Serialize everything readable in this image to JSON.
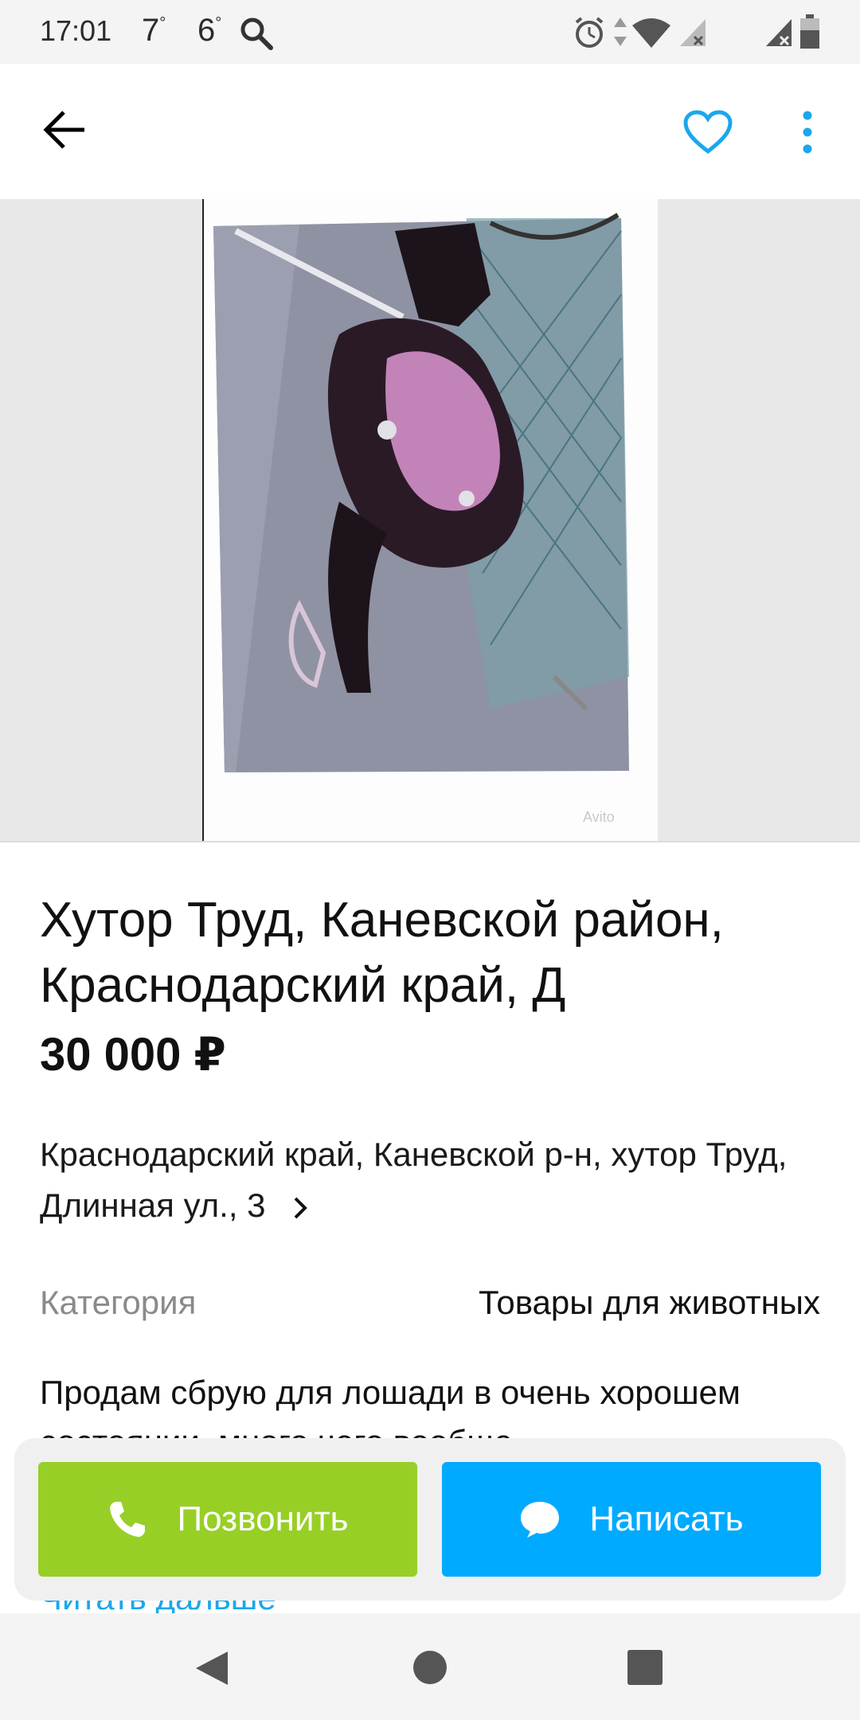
{
  "status_bar": {
    "time": "17:01",
    "temp1": "7",
    "temp2": "6",
    "icons": [
      "search-icon",
      "alarm-icon",
      "data-arrows-icon",
      "wifi-icon",
      "signal-icon",
      "signal-icon",
      "battery-icon"
    ]
  },
  "app_bar": {
    "back_icon": "arrow-left-icon",
    "favorite_icon": "heart-icon",
    "menu_icon": "more-vertical-icon",
    "accent_color": "#1aa7ee"
  },
  "gallery": {
    "watermark": "Avito"
  },
  "listing": {
    "title": "Хутор Труд, Каневской район, Краснодарский край, Д",
    "price": "30 000 ₽",
    "address": "Краснодарский край, Каневской р-н, хутор Труд, Длинная ул., 3",
    "category_label": "Категория",
    "category_value": "Товары для животных",
    "description": "Продам сбрую для лошади в очень хорошем состоянии, много чего вообще",
    "read_more": "Читать дальше"
  },
  "actions": {
    "call_label": "Позвонить",
    "call_color": "#97cf26",
    "write_label": "Написать",
    "write_color": "#00aaff"
  },
  "nav_bar": {
    "icons": [
      "back-triangle-icon",
      "home-circle-icon",
      "recents-square-icon"
    ]
  }
}
